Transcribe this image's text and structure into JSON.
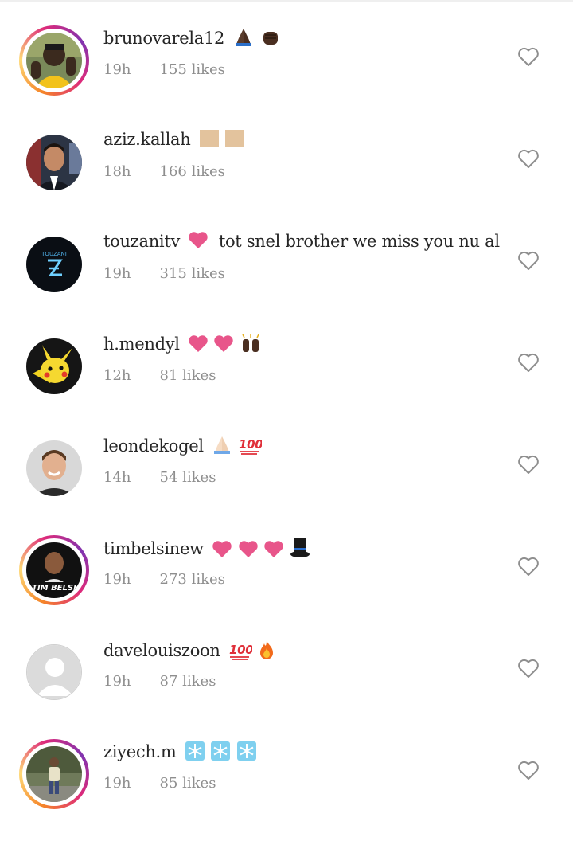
{
  "comments": [
    {
      "username": "brunovarela12",
      "text": "",
      "emojis": [
        "praying-hands-icon",
        "fist-icon"
      ],
      "time": "19h",
      "likes": "155 likes",
      "story_ring": true,
      "avatar": "football-player"
    },
    {
      "username": "aziz.kallah",
      "text": "",
      "emojis": [
        "tan-square-icon",
        "tan-square-icon"
      ],
      "time": "18h",
      "likes": "166 likes",
      "story_ring": false,
      "avatar": "man-portrait"
    },
    {
      "username": "touzanitv",
      "text": "tot snel brother we miss you nu al",
      "emojis": [
        "pink-heart-icon"
      ],
      "time": "19h",
      "likes": "315 likes",
      "story_ring": false,
      "avatar": "touzani-logo",
      "logo_text": "TOUZANI"
    },
    {
      "username": "h.mendyl",
      "text": "",
      "emojis": [
        "pink-heart-icon",
        "pink-heart-icon",
        "raised-hands-icon"
      ],
      "time": "12h",
      "likes": "81 likes",
      "story_ring": false,
      "avatar": "pikachu"
    },
    {
      "username": "leondekogel",
      "text": "",
      "emojis": [
        "praying-hands-icon",
        "hundred-points-icon"
      ],
      "time": "14h",
      "likes": "54 likes",
      "story_ring": false,
      "avatar": "man-smiling"
    },
    {
      "username": "timbelsinew",
      "text": "",
      "emojis": [
        "pink-heart-icon",
        "pink-heart-icon",
        "pink-heart-icon",
        "top-hat-icon"
      ],
      "time": "19h",
      "likes": "273 likes",
      "story_ring": true,
      "avatar": "timbelsi-logo",
      "logo_text": "TIM BELSI"
    },
    {
      "username": "davelouiszoon",
      "text": "",
      "emojis": [
        "hundred-points-icon",
        "fire-icon"
      ],
      "time": "19h",
      "likes": "87 likes",
      "story_ring": false,
      "avatar": "default-avatar"
    },
    {
      "username": "ziyech.m",
      "text": "",
      "emojis": [
        "snowflake-icon",
        "snowflake-icon",
        "snowflake-icon"
      ],
      "time": "19h",
      "likes": "85 likes",
      "story_ring": true,
      "avatar": "person-outdoors"
    }
  ],
  "colors": {
    "heart_pink": "#e8558a",
    "muted": "#8e8e8e",
    "text": "#262626",
    "icon_outline": "#8e8e8e"
  }
}
